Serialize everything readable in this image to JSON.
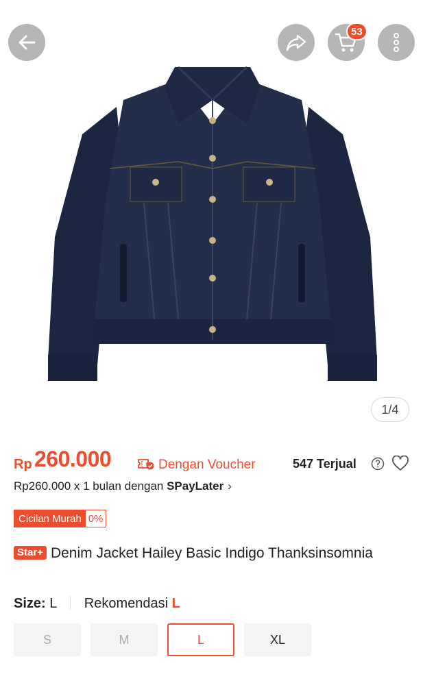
{
  "header": {
    "cart_count": "53",
    "image_pager": "1/4"
  },
  "icons": {
    "back": "arrow-left",
    "share": "share-arrow",
    "cart": "shopping-cart",
    "more": "vertical-ellipsis",
    "voucher": "voucher-ticket",
    "help": "question-circle",
    "wishlist": "heart-outline"
  },
  "product": {
    "currency": "Rp",
    "price": "260.000",
    "voucher_label": "Dengan Voucher",
    "sold": "547 Terjual",
    "paylater_prefix": "Rp260.000 x 1 bulan dengan ",
    "paylater_brand": "SPayLater",
    "paylater_chevron": "›",
    "installment_label": "Cicilan Murah",
    "installment_rate": "0%",
    "badge": "Star+",
    "title": "Denim Jacket Hailey Basic Indigo Thanksinsomnia"
  },
  "size": {
    "label": "Size:",
    "current": "L",
    "recommend_label": "Rekomendasi",
    "recommend_value": "L",
    "options": [
      "S",
      "M",
      "L",
      "XL"
    ],
    "selected": "L"
  },
  "colors": {
    "accent": "#ee4d2d",
    "denim": "#1f2a44"
  }
}
